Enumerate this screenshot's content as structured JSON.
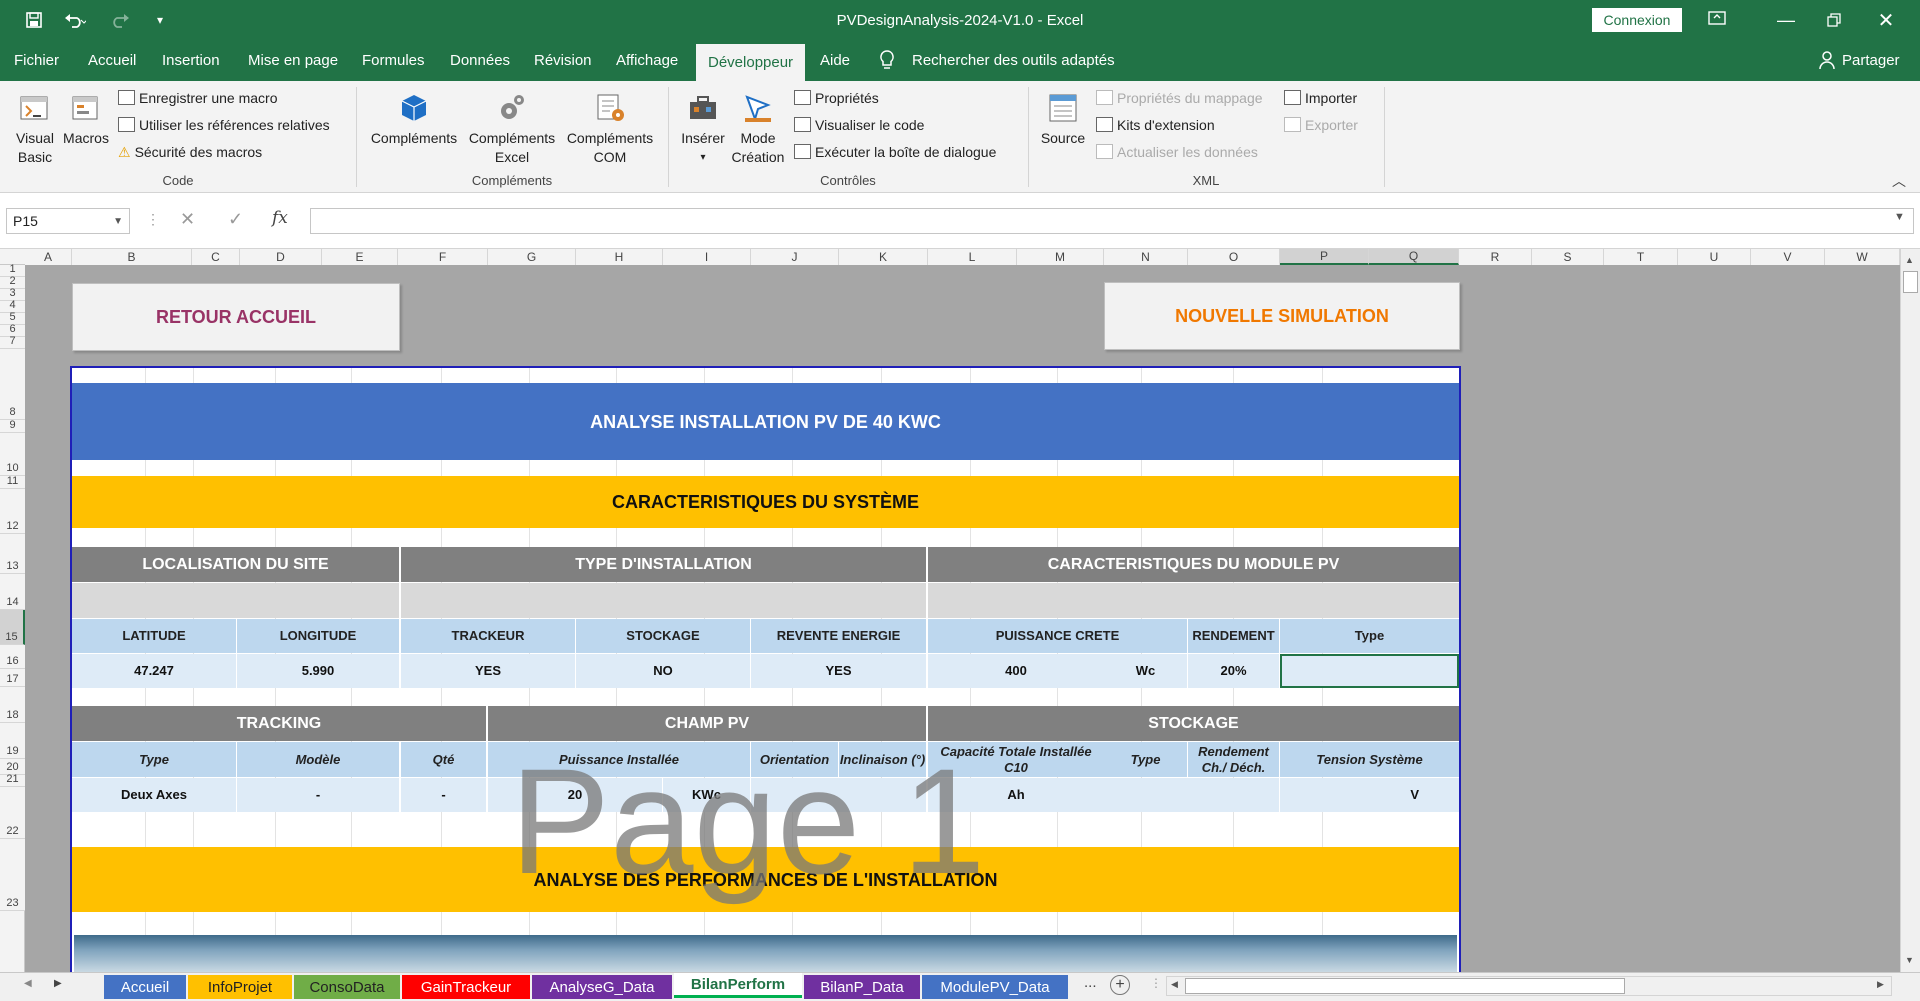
{
  "window": {
    "title": "PVDesignAnalysis-2024-V1.0  -  Excel",
    "connexion": "Connexion"
  },
  "tabs": [
    "Fichier",
    "Accueil",
    "Insertion",
    "Mise en page",
    "Formules",
    "Données",
    "Révision",
    "Affichage",
    "Développeur",
    "Aide"
  ],
  "active_tab": "Développeur",
  "search": "Rechercher des outils adaptés",
  "share": "Partager",
  "ribbon": {
    "code": {
      "visual_basic": [
        "Visual",
        "Basic"
      ],
      "macros": "Macros",
      "record": "Enregistrer une macro",
      "relative": "Utiliser les références relatives",
      "security": "Sécurité des macros",
      "label": "Code"
    },
    "addins": {
      "complements": "Compléments",
      "excel": [
        "Compléments",
        "Excel"
      ],
      "com": [
        "Compléments",
        "COM"
      ],
      "label": "Compléments"
    },
    "controls": {
      "insert": "Insérer",
      "design": [
        "Mode",
        "Création"
      ],
      "properties": "Propriétés",
      "view_code": "Visualiser le code",
      "run_dialog": "Exécuter la boîte de dialogue",
      "label": "Contrôles"
    },
    "xml": {
      "source": "Source",
      "map_props": "Propriétés du mappage",
      "expansion": "Kits d'extension",
      "refresh": "Actualiser les données",
      "import": "Importer",
      "export": "Exporter",
      "label": "XML"
    }
  },
  "formula_bar": {
    "name_box": "P15",
    "fx": "fx",
    "formula": ""
  },
  "columns": [
    "A",
    "B",
    "C",
    "D",
    "E",
    "F",
    "G",
    "H",
    "I",
    "J",
    "K",
    "L",
    "M",
    "N",
    "O",
    "P",
    "Q",
    "R",
    "S",
    "T",
    "U",
    "V",
    "W"
  ],
  "rows": [
    "1",
    "2",
    "3",
    "4",
    "5",
    "6",
    "7",
    "8",
    "9",
    "10",
    "11",
    "12",
    "13",
    "14",
    "15",
    "16",
    "17",
    "18",
    "19",
    "20",
    "21",
    "22",
    "23"
  ],
  "buttons": {
    "home": "RETOUR ACCUEIL",
    "new_sim": "NOUVELLE SIMULATION"
  },
  "report": {
    "title": "ANALYSE INSTALLATION PV DE 40 KWC",
    "section1": "CARACTERISTIQUES DU SYSTÈME",
    "site": "LOCALISATION DU SITE",
    "install_type": "TYPE D'INSTALLATION",
    "module": "CARACTERISTIQUES DU MODULE PV",
    "h_lat": "LATITUDE",
    "h_lon": "LONGITUDE",
    "h_tracker": "TRACKEUR",
    "h_storage": "STOCKAGE",
    "h_resale": "REVENTE ENERGIE",
    "h_peak": "PUISSANCE CRETE",
    "h_eff": "RENDEMENT",
    "h_type": "Type",
    "v_lat": "47.247",
    "v_lon": "5.990",
    "v_tracker": "YES",
    "v_storage": "NO",
    "v_resale": "YES",
    "v_peak": "400",
    "v_peak_unit": "Wc",
    "v_eff": "20%",
    "tracking": "TRACKING",
    "champ": "CHAMP PV",
    "stockage": "STOCKAGE",
    "t_type": "Type",
    "t_model": "Modèle",
    "t_qty": "Qté",
    "t_power": "Puissance Installée",
    "t_orient": "Orientation",
    "t_incl": "Inclinaison (°)",
    "t_cap": "Capacité Totale Installée C10",
    "t_stype": "Type",
    "t_yield": "Rendement Ch./ Déch.",
    "t_volt": "Tension Système",
    "r_type": "Deux Axes",
    "r_model": "-",
    "r_qty": "-",
    "r_power": "20",
    "r_power_unit": "KWc",
    "r_cap_unit": "Ah",
    "r_volt_unit": "V",
    "section2": "ANALYSE DES PERFORMANCES DE L'INSTALLATION",
    "watermark": "Page 1"
  },
  "sheet_tabs": [
    {
      "name": "Accueil",
      "color": "#4472c4"
    },
    {
      "name": "InfoProjet",
      "color": "#ffc000"
    },
    {
      "name": "ConsoData",
      "color": "#70ad47"
    },
    {
      "name": "GainTrackeur",
      "color": "#ff0000"
    },
    {
      "name": "AnalyseG_Data",
      "color": "#7030a0"
    },
    {
      "name": "BilanPerform",
      "color": "#00b050"
    },
    {
      "name": "BilanP_Data",
      "color": "#7030a0"
    },
    {
      "name": "ModulePV_Data",
      "color": "#4472c4"
    }
  ],
  "sheet_more": "..."
}
